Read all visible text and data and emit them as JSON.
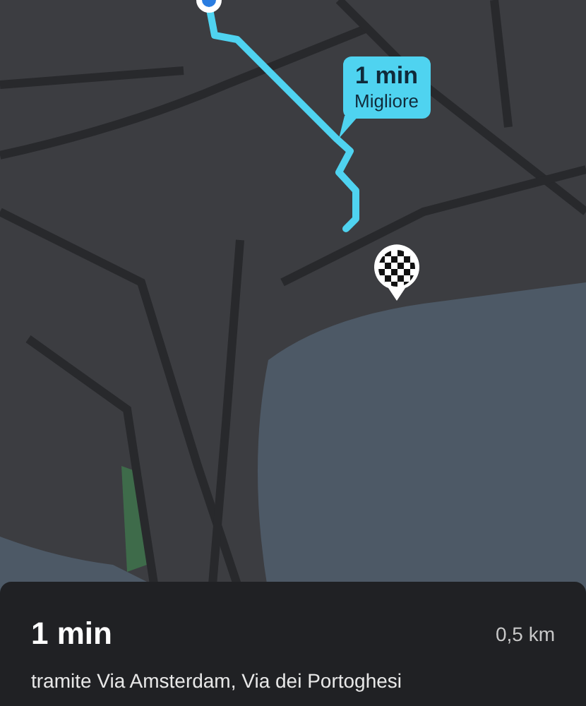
{
  "route_bubble": {
    "time": "1 min",
    "label": "Migliore"
  },
  "summary": {
    "duration": "1 min",
    "distance": "0,5 km",
    "via": "tramite Via Amsterdam, Via dei Portoghesi"
  }
}
